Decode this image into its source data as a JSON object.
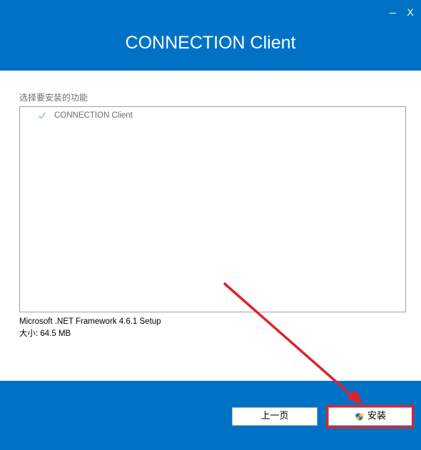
{
  "window": {
    "title": "CONNECTION Client",
    "minimize_label": "",
    "close_label": "X"
  },
  "features": {
    "label": "选择要安装的功能",
    "items": [
      {
        "label": "CONNECTION Client",
        "checked": true
      }
    ]
  },
  "info": {
    "framework": "Microsoft .NET Framework 4.6.1 Setup",
    "size": "大小: 64.5 MB"
  },
  "footer": {
    "back_label": "上一页",
    "install_label": "安装"
  },
  "colors": {
    "brand": "#0072c6",
    "highlight": "#e0212c"
  },
  "icons": {
    "install": "uac-shield-icon",
    "feature_check": "checkmark-icon"
  }
}
